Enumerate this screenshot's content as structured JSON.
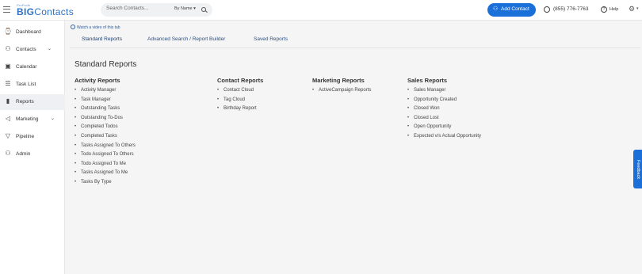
{
  "header": {
    "logo_small": "ProProfs",
    "logo_big_bold": "BIG",
    "logo_big": "Contacts",
    "search_placeholder": "Search Contacts...",
    "search_by": "By Name ▾",
    "add_contact": "Add Contact",
    "phone": "(855) 776-7763",
    "help": "Help"
  },
  "sidebar": {
    "items": [
      {
        "label": "Dashboard",
        "icon": "⌚"
      },
      {
        "label": "Contacts",
        "icon": "⚇"
      },
      {
        "label": "Calendar",
        "icon": "▣"
      },
      {
        "label": "Task List",
        "icon": "☰"
      },
      {
        "label": "Reports",
        "icon": "▮"
      },
      {
        "label": "Marketing",
        "icon": "◁"
      },
      {
        "label": "Pipeline",
        "icon": "▽"
      },
      {
        "label": "Admin",
        "icon": "⚇"
      }
    ]
  },
  "content": {
    "video_link": "Watch a video of this tab",
    "tabs": [
      "Standard Reports",
      "Advanced Search / Report Builder",
      "Saved Reports"
    ],
    "page_title": "Standard Reports",
    "columns": [
      {
        "title": "Activity Reports",
        "items": [
          "Activity Manager",
          "Task Manager",
          "Outstanding Tasks",
          "Outstanding To-Dos",
          "Completed Todos",
          "Completed Tasks",
          "Tasks Assigned To Others",
          "Todo Assigned To Others",
          "Todo Assigned To Me",
          "Tasks Assigned To Me",
          "Tasks By Type"
        ]
      },
      {
        "title": "Contact Reports",
        "items": [
          "Contact Cloud",
          "Tag Cloud",
          "Birthday Report"
        ]
      },
      {
        "title": "Marketing Reports",
        "items": [
          "ActiveCampaign Reports"
        ]
      },
      {
        "title": "Sales Reports",
        "items": [
          "Sales Manager",
          "Opportunity Created",
          "Closed Won",
          "Closed Lost",
          "Open Opportunity",
          "Expected v/s Actual Opportunity"
        ]
      }
    ]
  },
  "feedback": "Feedback",
  "colors": {
    "accent": "#1a6fd8",
    "brand": "#2f72c4"
  }
}
